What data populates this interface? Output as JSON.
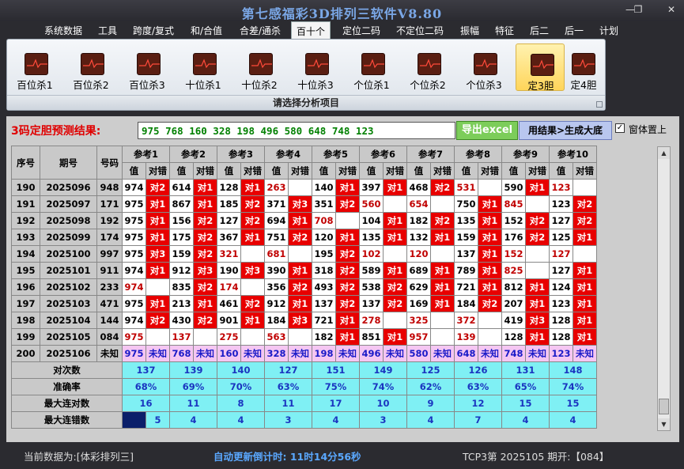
{
  "app": {
    "title": "第七感福彩3D排列三软件V8.80"
  },
  "menu": [
    "系统数据",
    "工具",
    "跨度/复式",
    "和/合值",
    "合差/通杀",
    "百十个",
    "定位二码",
    "不定位二码",
    "振幅",
    "特征",
    "后二",
    "后一",
    "计划"
  ],
  "menu_active_index": 5,
  "ribbon": {
    "buttons": [
      "百位杀1",
      "百位杀2",
      "百位杀3",
      "十位杀1",
      "十位杀2",
      "十位杀3",
      "个位杀1",
      "个位杀2",
      "个位杀3",
      "定3胆",
      "定4胆"
    ],
    "selected_index": 9,
    "caption": "请选择分析项目"
  },
  "prediction": {
    "label": "3码定胆预测结果:",
    "value": "975  768  160  328  198  496  580  648  748  123",
    "export_label": "导出excel",
    "generate_label": "用结果>生成大底",
    "pin_label": "窗体置上",
    "pin_checked": true
  },
  "table": {
    "fixed_headers": [
      "序号",
      "期号",
      "号码"
    ],
    "ref_headers": [
      "参考1",
      "参考2",
      "参考3",
      "参考4",
      "参考5",
      "参考6",
      "参考7",
      "参考8",
      "参考9",
      "参考10"
    ],
    "sub_headers": [
      "值",
      "对错"
    ],
    "rows": [
      {
        "seq": "190",
        "issue": "2025096",
        "num": "948",
        "cells": [
          [
            "974",
            "对2"
          ],
          [
            "614",
            "对1"
          ],
          [
            "128",
            "对1"
          ],
          [
            "263",
            ""
          ],
          [
            "140",
            "对1"
          ],
          [
            "397",
            "对1"
          ],
          [
            "468",
            "对2"
          ],
          [
            "531",
            ""
          ],
          [
            "590",
            "对1"
          ],
          [
            "123",
            ""
          ]
        ]
      },
      {
        "seq": "191",
        "issue": "2025097",
        "num": "171",
        "cells": [
          [
            "975",
            "对1"
          ],
          [
            "867",
            "对1"
          ],
          [
            "185",
            "对2"
          ],
          [
            "371",
            "对3"
          ],
          [
            "351",
            "对2"
          ],
          [
            "560",
            ""
          ],
          [
            "654",
            ""
          ],
          [
            "750",
            "对1"
          ],
          [
            "845",
            ""
          ],
          [
            "123",
            "对2"
          ]
        ]
      },
      {
        "seq": "192",
        "issue": "2025098",
        "num": "192",
        "cells": [
          [
            "975",
            "对1"
          ],
          [
            "156",
            "对2"
          ],
          [
            "127",
            "对2"
          ],
          [
            "694",
            "对1"
          ],
          [
            "708",
            ""
          ],
          [
            "104",
            "对1"
          ],
          [
            "182",
            "对2"
          ],
          [
            "135",
            "对1"
          ],
          [
            "152",
            "对2"
          ],
          [
            "127",
            "对2"
          ]
        ]
      },
      {
        "seq": "193",
        "issue": "2025099",
        "num": "174",
        "cells": [
          [
            "975",
            "对1"
          ],
          [
            "175",
            "对2"
          ],
          [
            "367",
            "对1"
          ],
          [
            "751",
            "对2"
          ],
          [
            "120",
            "对1"
          ],
          [
            "135",
            "对1"
          ],
          [
            "132",
            "对1"
          ],
          [
            "159",
            "对1"
          ],
          [
            "176",
            "对2"
          ],
          [
            "125",
            "对1"
          ]
        ]
      },
      {
        "seq": "194",
        "issue": "2025100",
        "num": "997",
        "cells": [
          [
            "975",
            "对3"
          ],
          [
            "159",
            "对2"
          ],
          [
            "321",
            ""
          ],
          [
            "681",
            ""
          ],
          [
            "195",
            "对2"
          ],
          [
            "102",
            ""
          ],
          [
            "120",
            ""
          ],
          [
            "137",
            "对1"
          ],
          [
            "152",
            ""
          ],
          [
            "127",
            ""
          ]
        ]
      },
      {
        "seq": "195",
        "issue": "2025101",
        "num": "911",
        "cells": [
          [
            "974",
            "对1"
          ],
          [
            "912",
            "对3"
          ],
          [
            "190",
            "对3"
          ],
          [
            "390",
            "对1"
          ],
          [
            "318",
            "对2"
          ],
          [
            "589",
            "对1"
          ],
          [
            "689",
            "对1"
          ],
          [
            "789",
            "对1"
          ],
          [
            "825",
            ""
          ],
          [
            "127",
            "对1"
          ]
        ]
      },
      {
        "seq": "196",
        "issue": "2025102",
        "num": "233",
        "cells": [
          [
            "974",
            ""
          ],
          [
            "835",
            "对2"
          ],
          [
            "174",
            ""
          ],
          [
            "356",
            "对2"
          ],
          [
            "493",
            "对2"
          ],
          [
            "538",
            "对2"
          ],
          [
            "629",
            "对1"
          ],
          [
            "721",
            "对1"
          ],
          [
            "812",
            "对1"
          ],
          [
            "124",
            "对1"
          ]
        ]
      },
      {
        "seq": "197",
        "issue": "2025103",
        "num": "471",
        "cells": [
          [
            "975",
            "对1"
          ],
          [
            "213",
            "对1"
          ],
          [
            "461",
            "对2"
          ],
          [
            "912",
            "对1"
          ],
          [
            "137",
            "对2"
          ],
          [
            "137",
            "对2"
          ],
          [
            "169",
            "对1"
          ],
          [
            "184",
            "对2"
          ],
          [
            "207",
            "对1"
          ],
          [
            "123",
            "对1"
          ]
        ]
      },
      {
        "seq": "198",
        "issue": "2025104",
        "num": "144",
        "cells": [
          [
            "974",
            "对2"
          ],
          [
            "430",
            "对2"
          ],
          [
            "901",
            "对1"
          ],
          [
            "184",
            "对3"
          ],
          [
            "721",
            "对1"
          ],
          [
            "278",
            ""
          ],
          [
            "325",
            ""
          ],
          [
            "372",
            ""
          ],
          [
            "419",
            "对3"
          ],
          [
            "128",
            "对1"
          ]
        ]
      },
      {
        "seq": "199",
        "issue": "2025105",
        "num": "084",
        "cells": [
          [
            "975",
            ""
          ],
          [
            "137",
            ""
          ],
          [
            "275",
            ""
          ],
          [
            "563",
            ""
          ],
          [
            "182",
            "对1"
          ],
          [
            "851",
            "对1"
          ],
          [
            "957",
            ""
          ],
          [
            "139",
            ""
          ],
          [
            "128",
            "对1"
          ],
          [
            "128",
            "对1"
          ]
        ]
      }
    ],
    "predict_row": {
      "seq": "200",
      "issue": "2025106",
      "num": "未知",
      "values": [
        "975",
        "768",
        "160",
        "328",
        "198",
        "496",
        "580",
        "648",
        "748",
        "123"
      ],
      "status": "未知"
    },
    "stats": [
      {
        "label": "对次数",
        "values": [
          "137",
          "139",
          "140",
          "127",
          "151",
          "149",
          "125",
          "126",
          "131",
          "148"
        ]
      },
      {
        "label": "准确率",
        "values": [
          "68%",
          "69%",
          "70%",
          "63%",
          "75%",
          "74%",
          "62%",
          "63%",
          "65%",
          "74%"
        ]
      },
      {
        "label": "最大连对数",
        "values": [
          "16",
          "11",
          "8",
          "11",
          "17",
          "10",
          "9",
          "12",
          "15",
          "15"
        ]
      },
      {
        "label": "最大连错数",
        "values": [
          "5",
          "4",
          "4",
          "3",
          "4",
          "3",
          "4",
          "7",
          "4",
          "4"
        ]
      }
    ]
  },
  "status": {
    "current": "当前数据为:[体彩排列三]",
    "countdown": "自动更新倒计时: 11时14分56秒",
    "issue": "TCP3第 2025105 期开:【084】"
  }
}
